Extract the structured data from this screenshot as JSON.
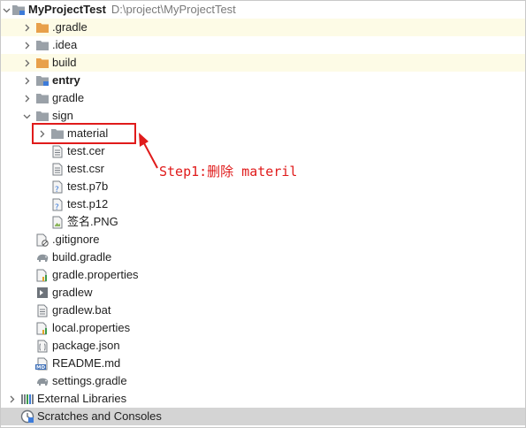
{
  "project": {
    "name": "MyProjectTest",
    "path": "D:\\project\\MyProjectTest"
  },
  "tree": [
    {
      "label": ".gradle",
      "indent": 1,
      "icon": "folder-orange-icon",
      "chevron": "collapsed",
      "highlight": true
    },
    {
      "label": ".idea",
      "indent": 1,
      "icon": "folder-gray-icon",
      "chevron": "collapsed"
    },
    {
      "label": "build",
      "indent": 1,
      "icon": "folder-orange-icon",
      "chevron": "collapsed",
      "highlight": true
    },
    {
      "label": "entry",
      "indent": 1,
      "icon": "module-folder-icon",
      "chevron": "collapsed",
      "bold": true
    },
    {
      "label": "gradle",
      "indent": 1,
      "icon": "folder-gray-icon",
      "chevron": "collapsed"
    },
    {
      "label": "sign",
      "indent": 1,
      "icon": "folder-gray-icon",
      "chevron": "expanded"
    },
    {
      "label": "material",
      "indent": 2,
      "icon": "folder-gray-icon",
      "chevron": "collapsed"
    },
    {
      "label": "test.cer",
      "indent": 2,
      "icon": "text-file-icon",
      "chevron": "none"
    },
    {
      "label": "test.csr",
      "indent": 2,
      "icon": "text-file-icon",
      "chevron": "none"
    },
    {
      "label": "test.p7b",
      "indent": 2,
      "icon": "unknown-file-icon",
      "chevron": "none"
    },
    {
      "label": "test.p12",
      "indent": 2,
      "icon": "unknown-file-icon",
      "chevron": "none"
    },
    {
      "label": "签名.PNG",
      "indent": 2,
      "icon": "image-file-icon",
      "chevron": "none"
    },
    {
      "label": ".gitignore",
      "indent": 1,
      "icon": "ignore-file-icon",
      "chevron": "none"
    },
    {
      "label": "build.gradle",
      "indent": 1,
      "icon": "gradle-elephant-icon",
      "chevron": "none"
    },
    {
      "label": "gradle.properties",
      "indent": 1,
      "icon": "properties-file-icon",
      "chevron": "none"
    },
    {
      "label": "gradlew",
      "indent": 1,
      "icon": "shell-script-icon",
      "chevron": "none"
    },
    {
      "label": "gradlew.bat",
      "indent": 1,
      "icon": "text-file-icon",
      "chevron": "none"
    },
    {
      "label": "local.properties",
      "indent": 1,
      "icon": "properties-file-icon",
      "chevron": "none"
    },
    {
      "label": "package.json",
      "indent": 1,
      "icon": "json-file-icon",
      "chevron": "none"
    },
    {
      "label": "README.md",
      "indent": 1,
      "icon": "markdown-file-icon",
      "chevron": "none"
    },
    {
      "label": "settings.gradle",
      "indent": 1,
      "icon": "gradle-elephant-icon",
      "chevron": "none"
    },
    {
      "label": "External Libraries",
      "indent": 0,
      "icon": "libraries-icon",
      "chevron": "collapsed"
    },
    {
      "label": "Scratches and Consoles",
      "indent": 0,
      "icon": "scratches-icon",
      "chevron": "none",
      "selected": true
    }
  ],
  "annotation": {
    "text": "Step1:删除 materil",
    "color": "#e01b1b"
  },
  "colors": {
    "highlight_row": "#fdfbe6",
    "selected_row": "#d4d4d4",
    "folder_orange": "#e8a04a",
    "folder_gray": "#9aa1a8"
  }
}
